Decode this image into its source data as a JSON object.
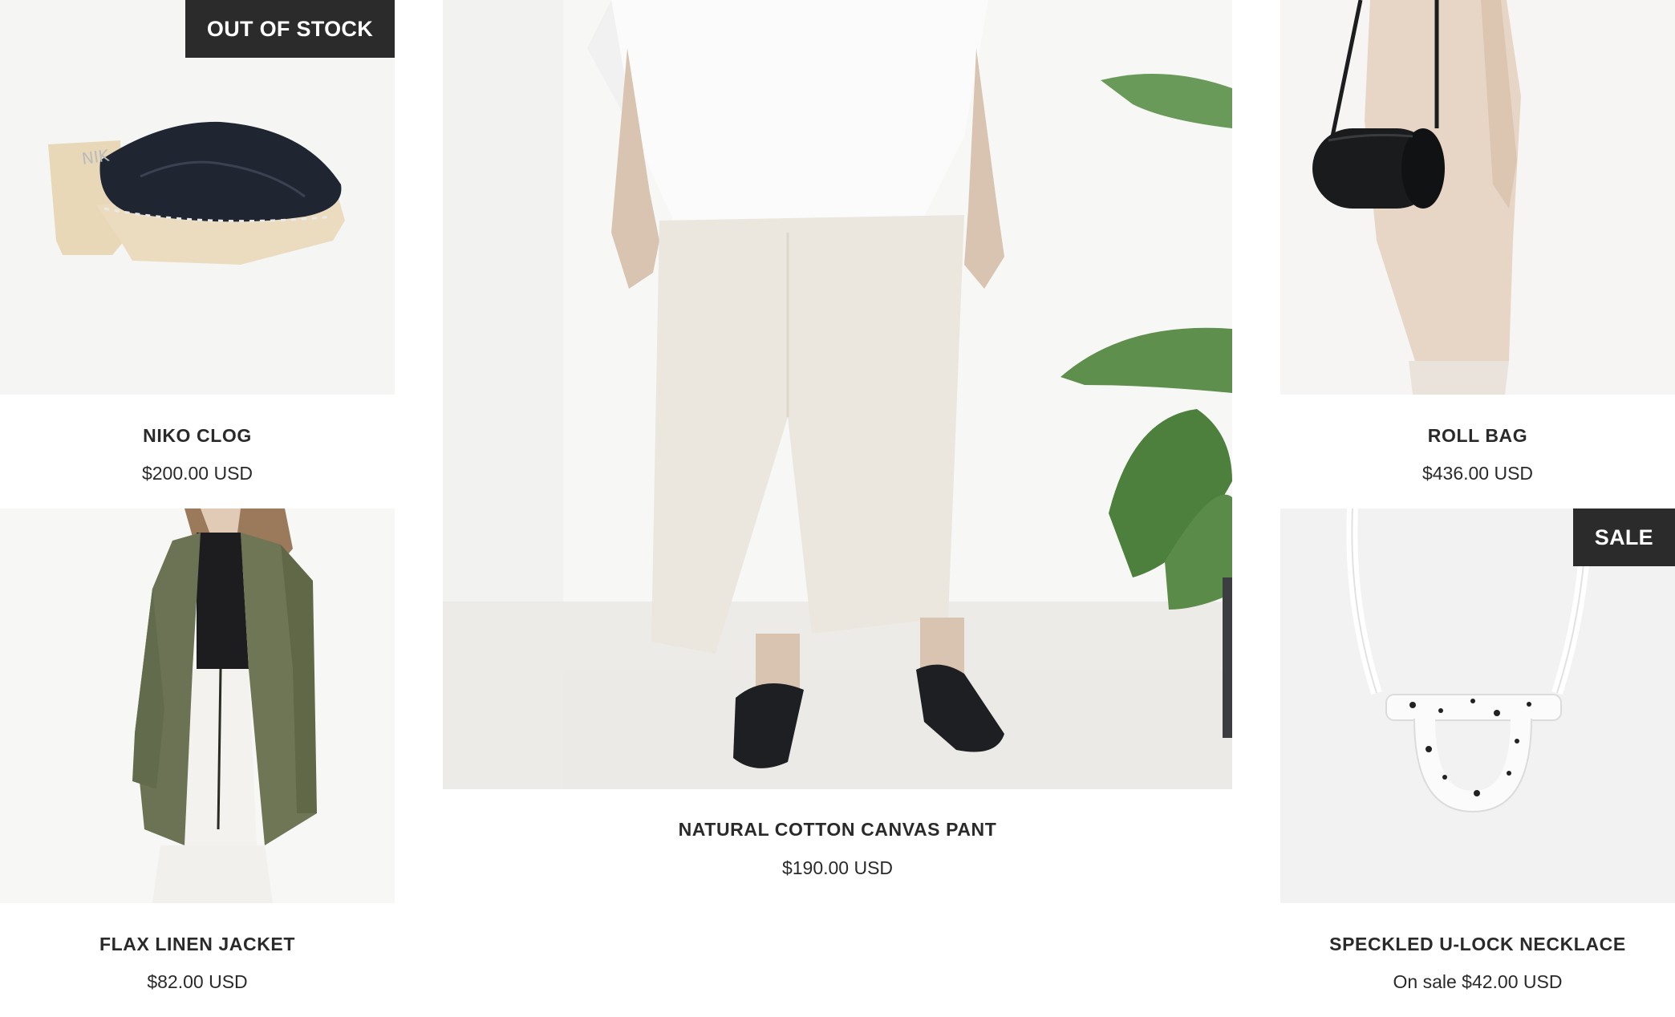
{
  "products": [
    {
      "title": "NIKO CLOG",
      "price": "$200.00 USD",
      "badge": "OUT OF STOCK",
      "image": "black-suede-clog-photo"
    },
    {
      "title": "NATURAL COTTON CANVAS PANT",
      "price": "$190.00 USD",
      "badge": "",
      "image": "model-wearing-cream-wide-pants-photo"
    },
    {
      "title": "ROLL BAG",
      "price": "$436.00 USD",
      "badge": "",
      "image": "black-cylinder-bag-photo"
    },
    {
      "title": "FLAX LINEN JACKET",
      "price": "$82.00 USD",
      "badge": "",
      "image": "olive-linen-jacket-photo"
    },
    {
      "title": "SPECKLED U-LOCK NECKLACE",
      "price": "On sale $42.00 USD",
      "badge": "SALE",
      "image": "speckled-u-lock-necklace-photo"
    }
  ],
  "colors": {
    "badge_bg": "#2b2b2b",
    "badge_text": "#ffffff",
    "text": "#2a2a2a",
    "background": "#ffffff"
  }
}
